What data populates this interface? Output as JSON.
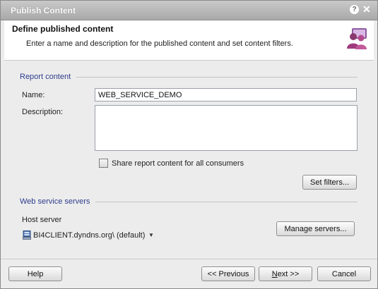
{
  "window": {
    "title": "Publish Content"
  },
  "icons": {
    "help": "help-question-icon",
    "close": "close-icon",
    "users": "users-icon",
    "server": "server-icon",
    "caret": "chevron-down-icon"
  },
  "header": {
    "title": "Define published content",
    "description": "Enter a name and description for the published content and set content filters."
  },
  "report_content": {
    "section_title": "Report content",
    "name_label": "Name:",
    "name_value": "WEB_SERVICE_DEMO",
    "description_label": "Description:",
    "description_value": "",
    "share_checkbox_label": "Share report content for all consumers",
    "share_checked": false,
    "set_filters_button": "Set filters..."
  },
  "web_service_servers": {
    "section_title": "Web service servers",
    "host_server_label": "Host server",
    "host_server_value": "BI4CLIENT.dyndns.org\\ (default)",
    "manage_servers_button": "Manage servers..."
  },
  "footer": {
    "help_button": "Help",
    "previous_button": "<< Previous",
    "next_button_first": "N",
    "next_button_rest": "ext >>",
    "cancel_button": "Cancel"
  },
  "colors": {
    "section_title": "#2d3d8c",
    "title_bar": "#b4b4b4"
  }
}
